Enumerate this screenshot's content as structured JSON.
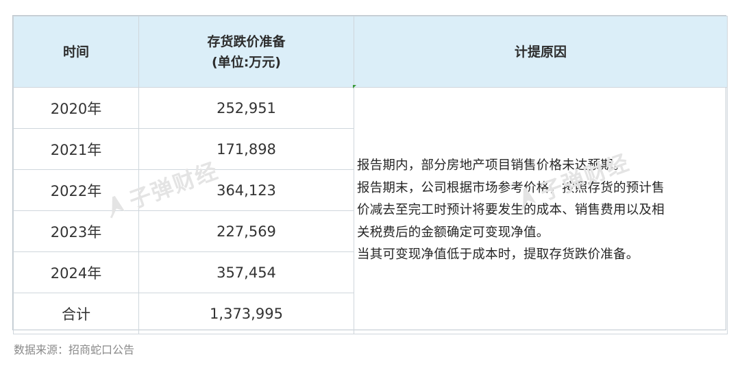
{
  "table": {
    "headers": {
      "time": "时间",
      "reserve_line1": "存货跌价准备",
      "reserve_line2": "(单位:万元)",
      "reason": "计提原因"
    },
    "rows": [
      {
        "year": "2020年",
        "amount": "252,951"
      },
      {
        "year": "2021年",
        "amount": "171,898"
      },
      {
        "year": "2022年",
        "amount": "364,123"
      },
      {
        "year": "2023年",
        "amount": "227,569"
      },
      {
        "year": "2024年",
        "amount": "357,454"
      },
      {
        "year": "合计",
        "amount": "1,373,995"
      }
    ],
    "reason_lines": [
      "报告期内，部分房地产项目销售价格未达预期。",
      "报告期末，公司根据市场参考价格，按照存货的预计售",
      "价减去至完工时预计将要发生的成本、销售费用以及相",
      "关税费后的金额确定可变现净值。",
      "当其可变现净值低于成本时，提取存货跌价准备。"
    ]
  },
  "watermark": {
    "text": "子弹财经",
    "icon": "rocket-logo-icon"
  },
  "source": "数据来源：招商蛇口公告",
  "colors": {
    "header_bg": "#dbeef8",
    "border": "#cfd6dc",
    "text": "#333333",
    "source_text": "#8a8a8a",
    "watermark": "#e4e4e4"
  }
}
